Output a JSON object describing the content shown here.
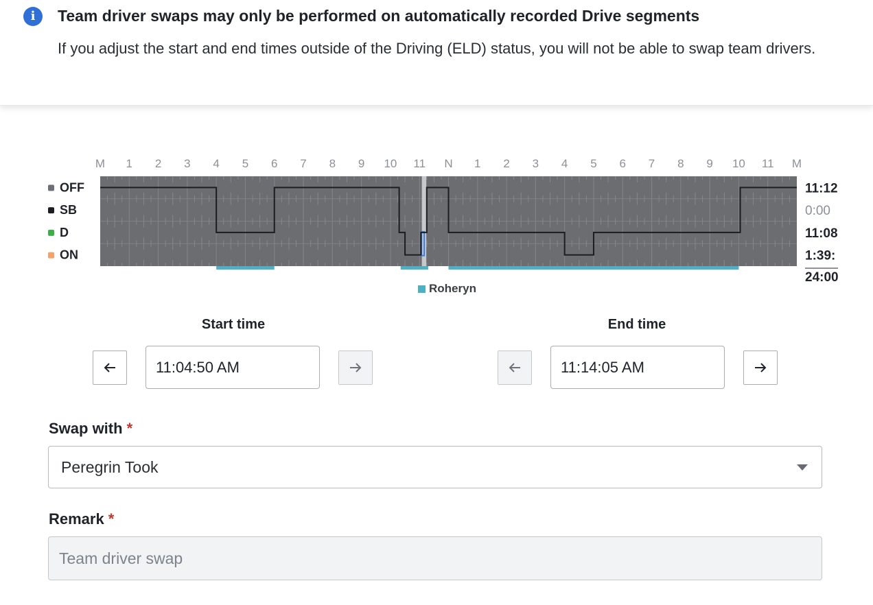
{
  "banner": {
    "title": "Team driver swaps may only be performed on automatically recorded Drive segments",
    "body": "If you adjust the start and end times outside of the Driving (ELD) status, you will not be able to swap team drivers."
  },
  "chart_data": {
    "type": "line",
    "hour_labels": [
      "M",
      "1",
      "2",
      "3",
      "4",
      "5",
      "6",
      "7",
      "8",
      "9",
      "10",
      "11",
      "N",
      "1",
      "2",
      "3",
      "4",
      "5",
      "6",
      "7",
      "8",
      "9",
      "10",
      "11",
      "M"
    ],
    "statuses": [
      {
        "label": "OFF",
        "color": "#6b7078",
        "total": "11:12:"
      },
      {
        "label": "SB",
        "color": "#1b1d20",
        "total": "0:00"
      },
      {
        "label": "D",
        "color": "#3fae49",
        "total": "11:08"
      },
      {
        "label": "ON",
        "color": "#f0a36b",
        "total": "1:39:"
      }
    ],
    "grand_total": "24:00",
    "status_steps": [
      {
        "h": 0,
        "s": 0
      },
      {
        "h": 4,
        "s": 2
      },
      {
        "h": 6,
        "s": 0
      },
      {
        "h": 10.3,
        "s": 2
      },
      {
        "h": 10.5,
        "s": 3
      },
      {
        "h": 11.05,
        "s": 2
      },
      {
        "h": 11.25,
        "s": 0
      },
      {
        "h": 12,
        "s": 2
      },
      {
        "h": 16,
        "s": 3
      },
      {
        "h": 17,
        "s": 2
      },
      {
        "h": 22.05,
        "s": 0
      },
      {
        "h": 24,
        "s": 0
      }
    ],
    "selection": {
      "start_hour": 11.081,
      "end_hour": 11.235
    },
    "driver_segments": [
      {
        "start": 4.0,
        "end": 6.0
      },
      {
        "start": 10.35,
        "end": 11.3
      },
      {
        "start": 12.0,
        "end": 22.0
      }
    ],
    "legend": {
      "name": "Roheryn",
      "color": "#4eb0c1"
    }
  },
  "start_time": {
    "label": "Start time",
    "value": "11:04:50 AM"
  },
  "end_time": {
    "label": "End time",
    "value": "11:14:05 AM"
  },
  "swap": {
    "label": "Swap with",
    "required_mark": "*",
    "value": "Peregrin Took"
  },
  "remark": {
    "label": "Remark",
    "required_mark": "*",
    "placeholder": "Team driver swap"
  }
}
